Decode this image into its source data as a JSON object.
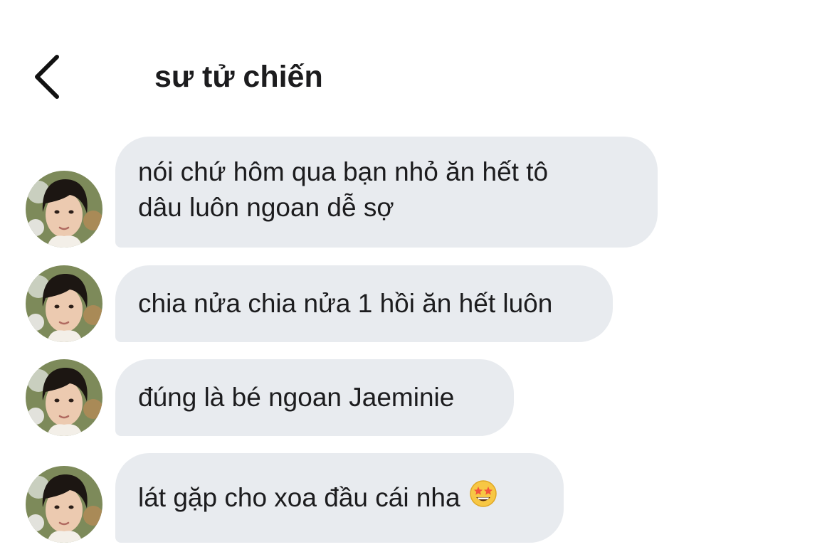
{
  "header": {
    "title": "sư tử chiến",
    "back_icon": "chevron-left-icon"
  },
  "messages": [
    {
      "text_line1": "nói chứ hôm qua bạn nhỏ ăn hết tô",
      "text_line2": "dâu luôn ngoan dễ sợ"
    },
    {
      "text": "chia nửa chia nửa 1 hồi ăn hết luôn"
    },
    {
      "text": "đúng là bé ngoan Jaeminie"
    },
    {
      "text": "lát gặp cho xoa đầu cái nha",
      "emoji": "star-struck-emoji-icon"
    }
  ],
  "colors": {
    "bubble": "#e8ebef",
    "text": "#1c1c1e",
    "background": "#ffffff"
  }
}
